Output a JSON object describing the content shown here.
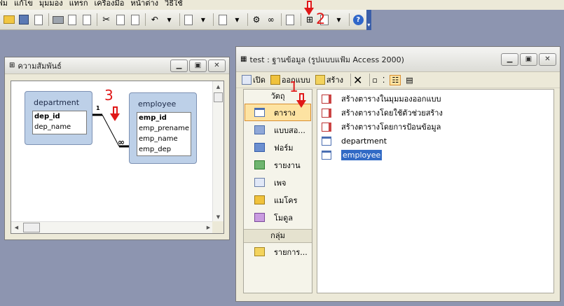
{
  "menu": [
    "ฟม",
    "แก้ไข",
    "มุมมอง",
    "แทรก",
    "เครื่องมือ",
    "หน้าต่าง",
    "วิธีใช้"
  ],
  "toolbar_icons": [
    "new-icon",
    "save-icon",
    "search-icon",
    "print-icon",
    "print-preview-icon",
    "spelling-icon",
    "cut-icon",
    "copy-icon",
    "paste-icon",
    "undo-icon",
    "office-links-icon",
    "analyze-icon",
    "properties-icon",
    "relationships-icon",
    "new-object-icon",
    "help-icon"
  ],
  "annotations": {
    "a1": "1",
    "a2": "2",
    "a3": "3"
  },
  "relationships": {
    "title": "ความสัมพันธ์",
    "line_one": "1",
    "line_many": "∞",
    "tables": [
      {
        "name": "department",
        "fields": [
          {
            "name": "dep_id",
            "pk": true
          },
          {
            "name": "dep_name",
            "pk": false
          }
        ]
      },
      {
        "name": "employee",
        "fields": [
          {
            "name": "emp_id",
            "pk": true
          },
          {
            "name": "emp_prename",
            "pk": false
          },
          {
            "name": "emp_name",
            "pk": false
          },
          {
            "name": "emp_dep",
            "pk": false
          }
        ]
      }
    ]
  },
  "database_window": {
    "title": "test : ฐานข้อมูล (รูปแบบแฟ้ม Access 2000)",
    "toolbar": {
      "open": "เปิด",
      "design": "ออกแบบ",
      "new": "สร้าง"
    },
    "objects_header": "วัตถุ",
    "objects": [
      "ตาราง",
      "แบบสอ...",
      "ฟอร์ม",
      "รายงาน",
      "เพจ",
      "แมโคร",
      "โมดูล"
    ],
    "groups_header": "กลุ่ม",
    "groups": [
      "รายการ..."
    ],
    "items": [
      {
        "label": "สร้างตารางในมุมมองออกแบบ",
        "kind": "wizard"
      },
      {
        "label": "สร้างตารางโดยใช้ตัวช่วยสร้าง",
        "kind": "wizard"
      },
      {
        "label": "สร้างตารางโดยการป้อนข้อมูล",
        "kind": "wizard"
      },
      {
        "label": "department",
        "kind": "table"
      },
      {
        "label": "employee",
        "kind": "table",
        "selected": true
      }
    ]
  },
  "colors": {
    "accent": "#e01818",
    "selection": "#316ac5",
    "object_selected": "#fde3a2"
  }
}
